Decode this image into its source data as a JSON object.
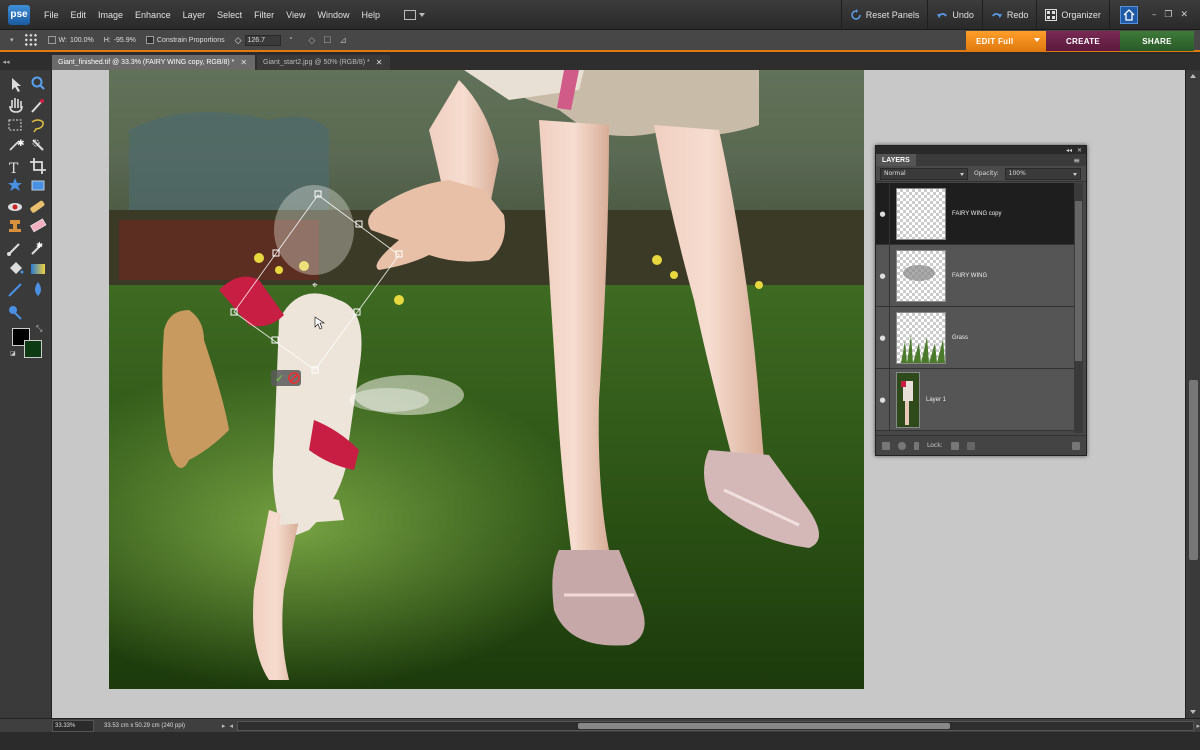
{
  "app": {
    "logo_text": "pse",
    "menus": [
      "File",
      "Edit",
      "Image",
      "Enhance",
      "Layer",
      "Select",
      "Filter",
      "View",
      "Window",
      "Help"
    ],
    "reset_panels": "Reset Panels",
    "undo": "Undo",
    "redo": "Redo",
    "organizer": "Organizer",
    "window_controls": [
      "–",
      "❐",
      "✕"
    ]
  },
  "options": {
    "w_label": "W:",
    "w_value": "100.0%",
    "h_label": "H:",
    "h_value": "-95.9%",
    "constrain_label": "Constrain Proportions",
    "angle_value": "126.7",
    "degree": "°"
  },
  "modes": {
    "edit": "EDIT Full",
    "create": "CREATE",
    "share": "SHARE"
  },
  "doc_tabs": [
    {
      "label": "Giant_finished.tif @ 33.3% (FAIRY WING copy, RGB/8) *",
      "close": "✕"
    },
    {
      "label": "Giant_start2.jpg @ 50% (RGB/8) *",
      "close": "✕"
    }
  ],
  "status": {
    "zoom": "33.33%",
    "size": "33.53 cm x 50.29 cm (240 ppi)"
  },
  "layers_panel": {
    "title": "LAYERS",
    "blend_mode": "Normal",
    "opacity_label": "Opacity:",
    "opacity_value": "100%",
    "lock_label": "Lock:",
    "layers": [
      {
        "name": "FAIRY WING copy",
        "selected": true
      },
      {
        "name": "FAIRY WING",
        "selected": false
      },
      {
        "name": "Grass",
        "selected": false
      },
      {
        "name": "Layer 1",
        "selected": false
      }
    ]
  },
  "colors": {
    "accent": "#e07a10",
    "create": "#6a2248",
    "share": "#356b31",
    "foreground": "#000000",
    "background": "#0d3a12"
  }
}
